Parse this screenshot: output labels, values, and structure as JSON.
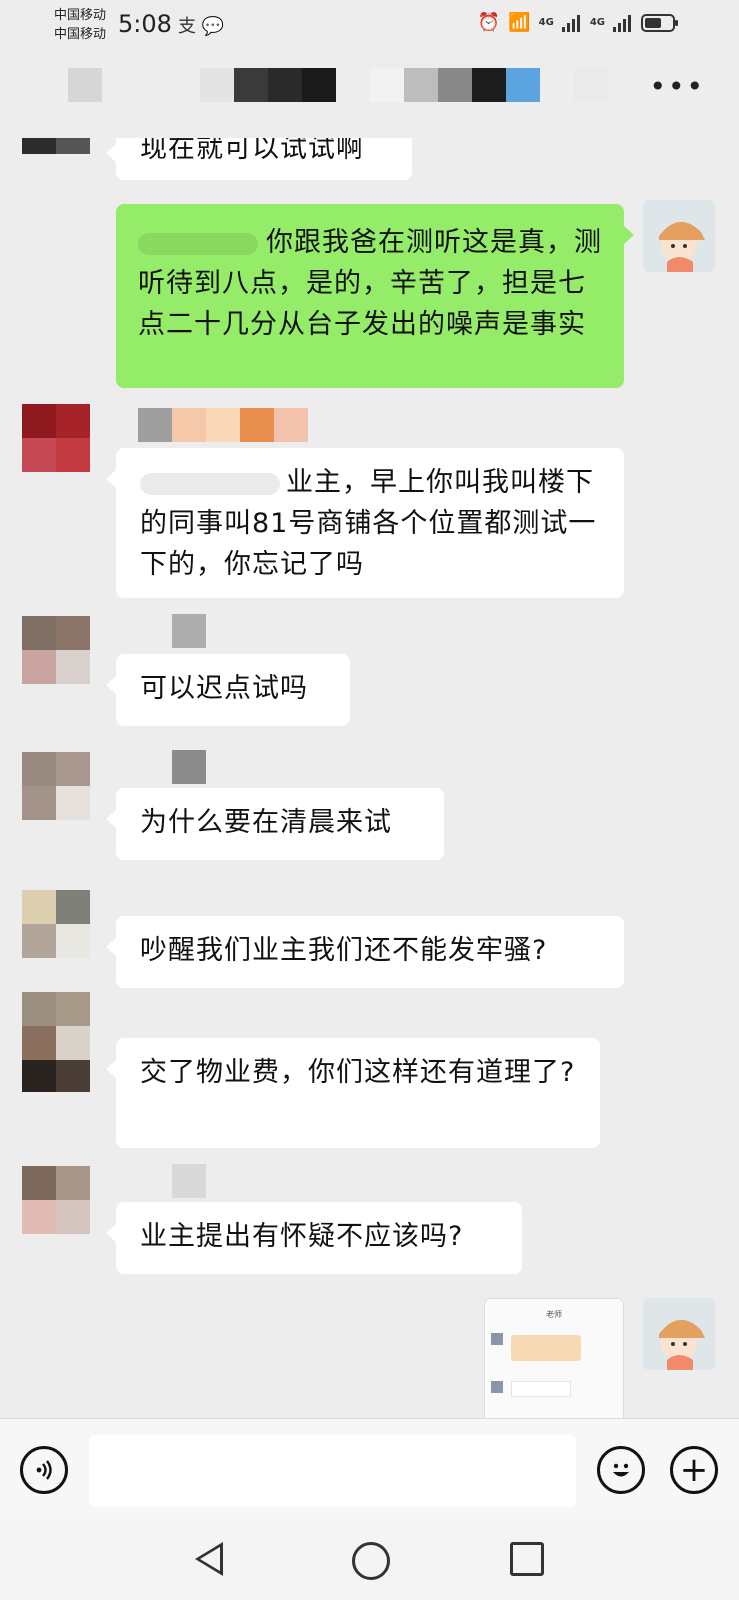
{
  "status_bar": {
    "carrier_1": "中国移动",
    "carrier_2": "中国移动",
    "time": "5:08",
    "net_1": "4G",
    "net_2": "4G",
    "battery_level": 0.6
  },
  "messages": [
    {
      "side": "left",
      "text": "现在就可以试试啊"
    },
    {
      "side": "right",
      "text": "你跟我爸在测听这是真，测听待到八点，是的，辛苦了，担是七点二十几分从台子发出的噪声是事实"
    },
    {
      "side": "left",
      "text": "业主，早上你叫我叫楼下的同事叫81号商铺各个位置都测试一下的，你忘记了吗"
    },
    {
      "side": "left",
      "text": "可以迟点试吗"
    },
    {
      "side": "left",
      "text": "为什么要在清晨来试"
    },
    {
      "side": "left",
      "text": "吵醒我们业主我们还不能发牢骚?"
    },
    {
      "side": "left",
      "text": "交了物业费，你们这样还有道理了?"
    },
    {
      "side": "left",
      "text": "业主提出有怀疑不应该吗?"
    }
  ],
  "image_message": {
    "header": "老师"
  },
  "input": {
    "placeholder": ""
  },
  "icons": {
    "more": "more-icon",
    "voice": "voice-icon",
    "emoji": "emoji-icon",
    "plus": "plus-icon",
    "back": "back-icon",
    "home": "home-icon",
    "recent": "recent-apps-icon"
  },
  "colors": {
    "sent_bubble": "#95ec69",
    "received_bubble": "#ffffff",
    "background": "#ededed"
  }
}
